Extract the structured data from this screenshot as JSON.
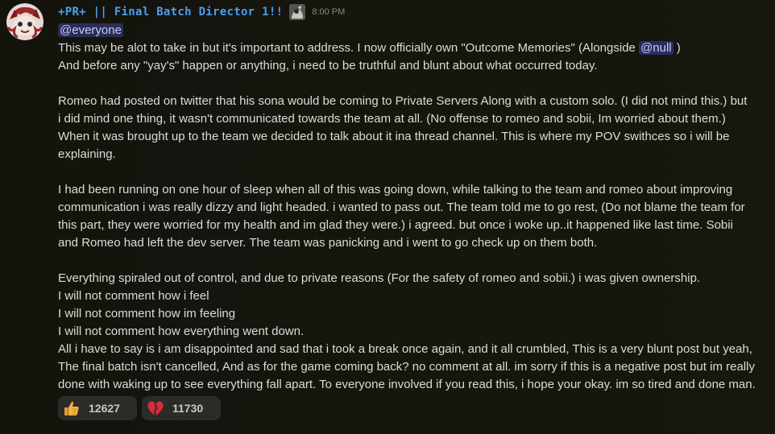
{
  "message": {
    "author": "+PR+ || Final Batch Director 1!!",
    "timestamp": "8:00 PM",
    "mentions": {
      "everyone": "@everyone",
      "null": "@null"
    },
    "paragraph1": {
      "l1_pre": "This may be alot to take in but it's important to address. I now officially own \"Outcome Memories\" (Alongside ",
      "l1_post": " )",
      "l2": "And before any \"yay's\" happen or anything, i need to be truthful and blunt about what occurred today."
    },
    "paragraph2": [
      "Romeo had posted on twitter that his sona would be coming to Private Servers Along with a custom solo. (I did not mind this.) but",
      "i did mind one thing, it wasn't communicated towards the team at all. (No offense to romeo and sobii, Im worried about them.)",
      "When it was brought up to the team we decided to talk about it ina  thread channel. This is where my POV swithces so i will be",
      "explaining."
    ],
    "paragraph3": [
      "I had been running on one hour of sleep when all of this was going down, while talking to the team and romeo about improving",
      "communication i was really dizzy and light headed. i wanted to pass out. The team told me to go rest, (Do not blame the team for",
      "this part, they were worried for my health and im glad they were.) i agreed. but once i woke up..it happened like last time. Sobii",
      "and Romeo had left the dev server. The team was panicking and i went to go check up on them both."
    ],
    "paragraph4": [
      "Everything spiraled out of control, and due to private reasons (For the safety of romeo and sobii.) i was given ownership.",
      "I will not comment how i feel",
      "I will not comment how im feeling",
      "I will not comment how everything went down.",
      "All i have to say is i am disappointed and sad that i took a break once again, and it all crumbled, This is a very blunt post but yeah,",
      "The final batch isn't cancelled, And as for the game coming back? no comment at all. im sorry if this is a negative post but im really",
      "done with waking up to see everything fall apart. To everyone involved if you read this, i hope your okay. im so tired and done man."
    ]
  },
  "reactions": [
    {
      "emoji": "thumbs-up",
      "count": "12627"
    },
    {
      "emoji": "broken-heart",
      "count": "11730"
    }
  ],
  "colors": {
    "background": "#16150f",
    "username": "#4a9ff0",
    "text": "#dcdcd8",
    "mention_bg": "#3c4182",
    "reaction_bg": "#2b2b27"
  }
}
